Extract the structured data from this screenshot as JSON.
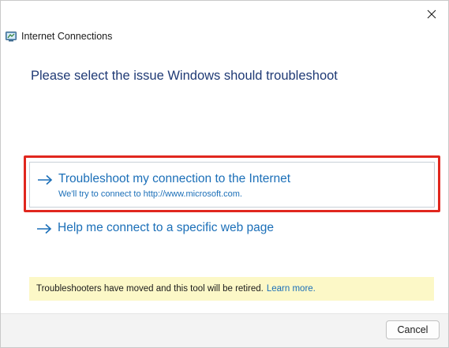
{
  "window": {
    "title": "Internet Connections",
    "icon": "network-connections-icon",
    "close_icon": "close-icon"
  },
  "heading": "Please select the issue Windows should troubleshoot",
  "options": [
    {
      "title": "Troubleshoot my connection to the Internet",
      "description": "We'll try to connect to http://www.microsoft.com.",
      "icon": "arrow-right-icon",
      "selected": true
    },
    {
      "title": "Help me connect to a specific web page",
      "icon": "arrow-right-icon",
      "selected": false
    }
  ],
  "notice": {
    "text": "Troubleshooters have moved and this tool will be retired.",
    "link": "Learn more."
  },
  "footer": {
    "cancel_label": "Cancel"
  },
  "colors": {
    "accent": "#1b6fb8",
    "heading": "#1f3a75",
    "highlight": "#e0271e",
    "notice_bg": "#fcf8c7"
  }
}
